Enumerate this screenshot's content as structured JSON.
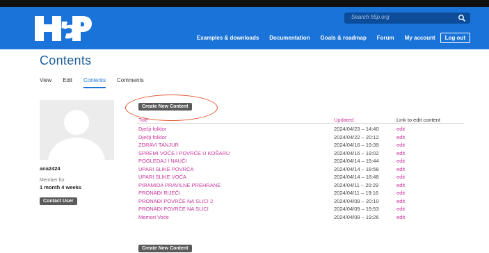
{
  "header": {
    "logo_alt": "H5P",
    "search_placeholder": "Search h5p.org",
    "nav": [
      "Examples & downloads",
      "Documentation",
      "Goals & roadmap",
      "Forum",
      "My account"
    ],
    "logout_label": "Log out"
  },
  "page": {
    "title": "Contents",
    "tabs": [
      {
        "label": "View",
        "active": false
      },
      {
        "label": "Edit",
        "active": false
      },
      {
        "label": "Contents",
        "active": true
      },
      {
        "label": "Comments",
        "active": false
      }
    ]
  },
  "profile": {
    "username": "ana2424",
    "member_label": "Member for",
    "member_value": "1 month 4 weeks",
    "contact_label": "Contact User"
  },
  "content": {
    "create_label": "Create New Content",
    "columns": {
      "title": "Title",
      "updated": "Updated",
      "link": "Link to edit content"
    },
    "rows": [
      {
        "title": "Dječji folklor",
        "updated": "2024/04/23 – 14:40",
        "link": "edit"
      },
      {
        "title": "Dječji folklor",
        "updated": "2024/04/22 – 20:12",
        "link": "edit"
      },
      {
        "title": "ZDRAVI TANJUR",
        "updated": "2024/04/16 – 19:39",
        "link": "edit"
      },
      {
        "title": "SPREMI VOĆE I POVRĆE U KOŠARU",
        "updated": "2024/04/16 – 19:02",
        "link": "edit"
      },
      {
        "title": "POGLEDAJ I NAUČI",
        "updated": "2024/04/14 – 19:44",
        "link": "edit"
      },
      {
        "title": "UPARI SLIKE POVRĆA",
        "updated": "2024/04/14 – 18:58",
        "link": "edit"
      },
      {
        "title": "UPARI SLIKE VOĆA",
        "updated": "2024/04/14 – 18:48",
        "link": "edit"
      },
      {
        "title": "PIRAMIDA PRAVILNE PREHRANE",
        "updated": "2024/04/11 – 20:29",
        "link": "edit"
      },
      {
        "title": "PRONAĐI RIJEČI",
        "updated": "2024/04/11 – 19:16",
        "link": "edit"
      },
      {
        "title": "PRONAĐI POVRĆE NA SLICI 2",
        "updated": "2024/04/09 – 20:10",
        "link": "edit"
      },
      {
        "title": "PRONAĐI POVRĆE NA SLICI",
        "updated": "2024/04/09 – 19:53",
        "link": "edit"
      },
      {
        "title": "Memori Voće",
        "updated": "2024/04/09 – 19:26",
        "link": "edit"
      }
    ]
  },
  "colors": {
    "header_bg": "#1a73d9",
    "accent_pink": "#c7379a",
    "title_blue": "#1f5d99",
    "annotation_circle": "#e0532a",
    "button_dark": "#5a5a5a"
  }
}
